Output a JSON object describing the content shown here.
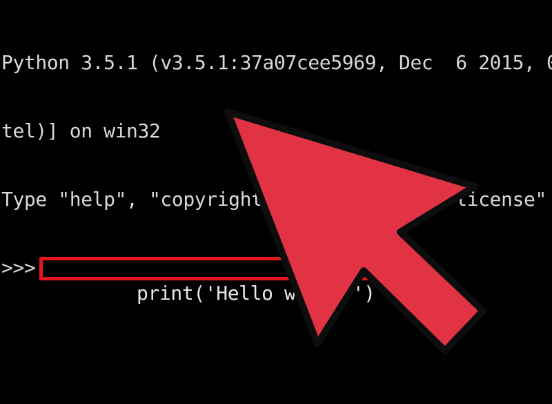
{
  "console": {
    "lines": [
      "Python 3.5.1 (v3.5.1:37a07cee5969, Dec  6 2015, 0",
      "tel)] on win32",
      "Type \"help\", \"copyright\", \"credits\" or \"license\" "
    ],
    "prompt": ">>>",
    "command": "print('Hello world!')"
  },
  "colors": {
    "background": "#000000",
    "text": "#d9d9d9",
    "highlight_box": "#e2161c",
    "arrow_fill": "#e23345",
    "arrow_outline": "#0d0d0d"
  },
  "icons": {
    "pointer": "arrow-pointer-icon"
  }
}
